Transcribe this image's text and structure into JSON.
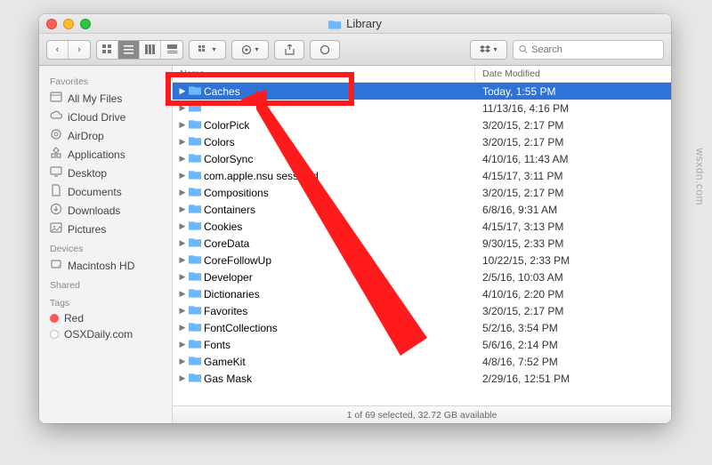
{
  "window": {
    "title": "Library",
    "status": "1 of 69 selected, 32.72 GB available"
  },
  "search": {
    "placeholder": "Search"
  },
  "columns": {
    "name": "Name",
    "modified": "Date Modified"
  },
  "sidebar": {
    "sections": [
      {
        "title": "Favorites",
        "items": [
          {
            "label": "All My Files",
            "icon": "all-files"
          },
          {
            "label": "iCloud Drive",
            "icon": "cloud"
          },
          {
            "label": "AirDrop",
            "icon": "airdrop"
          },
          {
            "label": "Applications",
            "icon": "apps"
          },
          {
            "label": "Desktop",
            "icon": "desktop"
          },
          {
            "label": "Documents",
            "icon": "documents"
          },
          {
            "label": "Downloads",
            "icon": "downloads"
          },
          {
            "label": "Pictures",
            "icon": "pictures"
          }
        ]
      },
      {
        "title": "Devices",
        "items": [
          {
            "label": "Macintosh HD",
            "icon": "disk"
          }
        ]
      },
      {
        "title": "Shared",
        "items": []
      },
      {
        "title": "Tags",
        "items": [
          {
            "label": "Red",
            "tag": "#ff5552"
          },
          {
            "label": "OSXDaily.com",
            "tag": "#fff",
            "border": "#bbb"
          }
        ]
      }
    ]
  },
  "folder_color": "#6bb8ff",
  "files": [
    {
      "name": "Caches",
      "modified": "Today, 1:55 PM",
      "selected": true
    },
    {
      "name": "",
      "modified": "11/13/16, 4:16 PM"
    },
    {
      "name": "ColorPick",
      "modified": "3/20/15, 2:17 PM",
      "truncated": true
    },
    {
      "name": "Colors",
      "modified": "3/20/15, 2:17 PM"
    },
    {
      "name": "ColorSync",
      "modified": "4/10/16, 11:43 AM"
    },
    {
      "name": "com.apple.nsu",
      "modified": "4/15/17, 3:11 PM",
      "suffix": "sessiond"
    },
    {
      "name": "Compositions",
      "modified": "3/20/15, 2:17 PM"
    },
    {
      "name": "Containers",
      "modified": "6/8/16, 9:31 AM"
    },
    {
      "name": "Cookies",
      "modified": "4/15/17, 3:13 PM"
    },
    {
      "name": "CoreData",
      "modified": "9/30/15, 2:33 PM"
    },
    {
      "name": "CoreFollowUp",
      "modified": "10/22/15, 2:33 PM"
    },
    {
      "name": "Developer",
      "modified": "2/5/16, 10:03 AM"
    },
    {
      "name": "Dictionaries",
      "modified": "4/10/16, 2:20 PM"
    },
    {
      "name": "Favorites",
      "modified": "3/20/15, 2:17 PM"
    },
    {
      "name": "FontCollections",
      "modified": "5/2/16, 3:54 PM"
    },
    {
      "name": "Fonts",
      "modified": "5/6/16, 2:14 PM"
    },
    {
      "name": "GameKit",
      "modified": "4/8/16, 7:52 PM"
    },
    {
      "name": "Gas Mask",
      "modified": "2/29/16, 12:51 PM"
    }
  ],
  "watermark": "wsxdn.com"
}
